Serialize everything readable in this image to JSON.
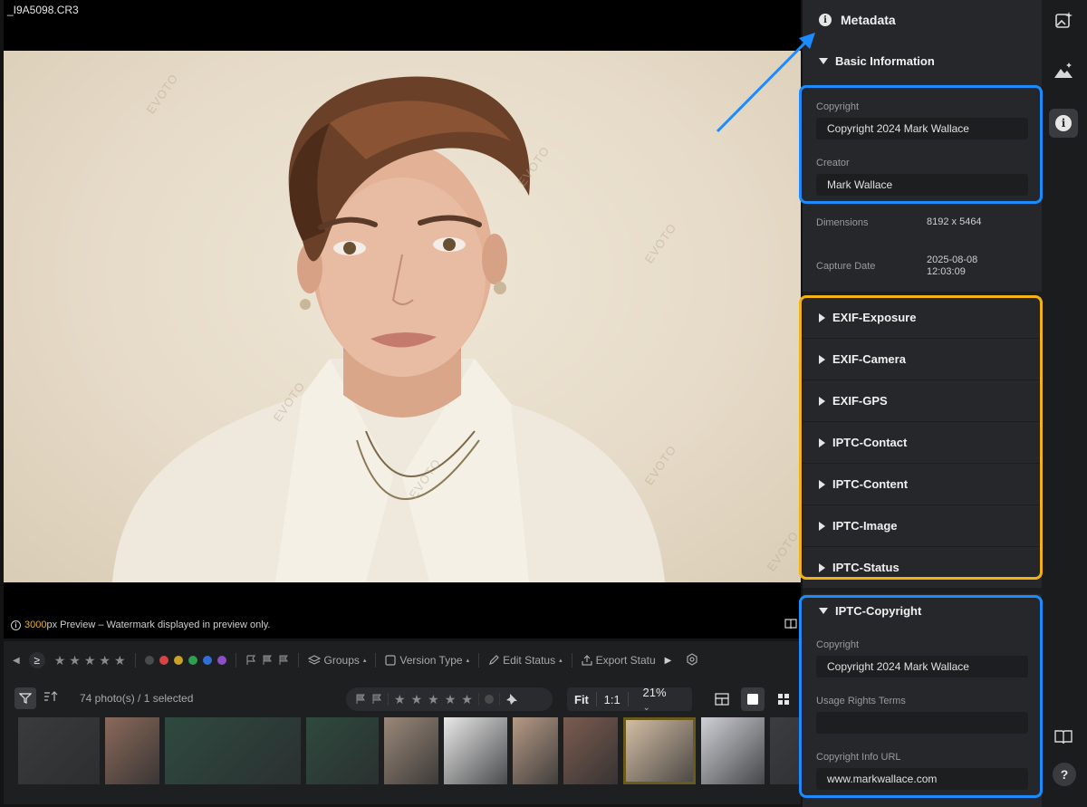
{
  "viewer": {
    "filename": "_I9A5098.CR3",
    "watermark_text": "EVOTO",
    "preview_px": "3000",
    "preview_text": "px Preview – Watermark displayed in preview only."
  },
  "toolbar": {
    "gte_label": "≥",
    "groups_label": "Groups",
    "version_type_label": "Version Type",
    "edit_status_label": "Edit Status",
    "export_status_label": "Export Statu",
    "photo_count": "74 photo(s) / 1 selected",
    "zoom_fit": "Fit",
    "zoom_one": "1:1",
    "zoom_value": "21%",
    "color_labels": [
      "#c0392b",
      "#d64545",
      "#c9a227",
      "#2e9e4f",
      "#2f6fd6",
      "#8a4fc9"
    ],
    "thumbnail_colors": [
      "#3a3b3d",
      "#8a6a5a",
      "#2f4a40",
      "#2e4a3e",
      "#9a8878",
      "#e8e8e8",
      "#b59a86",
      "#7a5c50",
      "#d8c2a8",
      "#cfcfd6",
      "#3c3d40"
    ]
  },
  "panel": {
    "title": "Metadata",
    "basic_info": {
      "heading": "Basic Information",
      "copyright_label": "Copyright",
      "copyright_value": "Copyright 2024 Mark Wallace",
      "creator_label": "Creator",
      "creator_value": "Mark Wallace",
      "dimensions_label": "Dimensions",
      "dimensions_value": "8192 x 5464",
      "capture_date_label": "Capture Date",
      "capture_date_value": "2025-08-08",
      "capture_time_value": "12:03:09"
    },
    "collapsed_sections": [
      "EXIF-Exposure",
      "EXIF-Camera",
      "EXIF-GPS",
      "IPTC-Contact",
      "IPTC-Content",
      "IPTC-Image",
      "IPTC-Status"
    ],
    "iptc_copyright": {
      "heading": "IPTC-Copyright",
      "copyright_label": "Copyright",
      "copyright_value": "Copyright 2024 Mark Wallace",
      "usage_label": "Usage Rights Terms",
      "usage_value": "",
      "url_label": "Copyright Info URL",
      "url_value": "www.markwallace.com"
    }
  },
  "rail": {
    "help_label": "?"
  },
  "colors": {
    "highlight_blue": "#1a8cff",
    "highlight_gold": "#f2b312",
    "preview_accent": "#e0b12a"
  }
}
